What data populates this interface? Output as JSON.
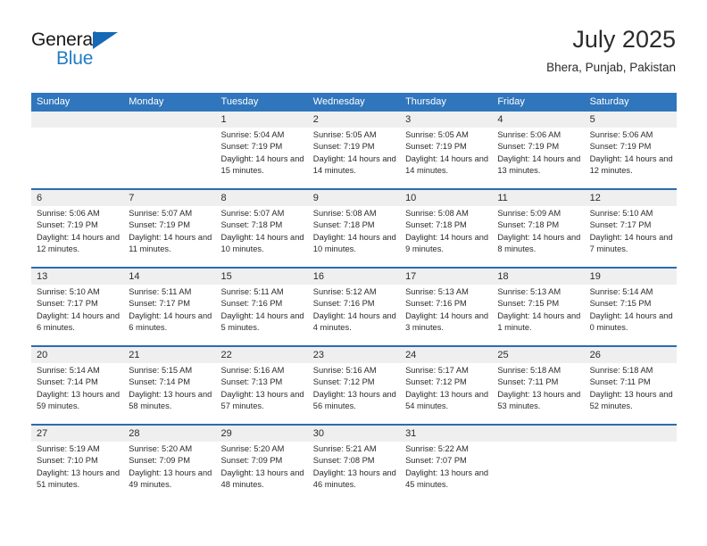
{
  "brand": {
    "name_part1": "General",
    "name_part2": "Blue",
    "triangle_color": "#1669b5",
    "blue_color": "#1f7ec4"
  },
  "header": {
    "title": "July 2025",
    "location": "Bhera, Punjab, Pakistan"
  },
  "theme": {
    "header_blue": "#3076bc",
    "separator_blue": "#2b6cad",
    "date_band_gray": "#efefef",
    "text_color": "#2b2b2b"
  },
  "weekdays": [
    "Sunday",
    "Monday",
    "Tuesday",
    "Wednesday",
    "Thursday",
    "Friday",
    "Saturday"
  ],
  "weeks": [
    [
      {
        "date": "",
        "sunrise": "",
        "sunset": "",
        "daylight": ""
      },
      {
        "date": "",
        "sunrise": "",
        "sunset": "",
        "daylight": ""
      },
      {
        "date": "1",
        "sunrise": "Sunrise: 5:04 AM",
        "sunset": "Sunset: 7:19 PM",
        "daylight": "Daylight: 14 hours and 15 minutes."
      },
      {
        "date": "2",
        "sunrise": "Sunrise: 5:05 AM",
        "sunset": "Sunset: 7:19 PM",
        "daylight": "Daylight: 14 hours and 14 minutes."
      },
      {
        "date": "3",
        "sunrise": "Sunrise: 5:05 AM",
        "sunset": "Sunset: 7:19 PM",
        "daylight": "Daylight: 14 hours and 14 minutes."
      },
      {
        "date": "4",
        "sunrise": "Sunrise: 5:06 AM",
        "sunset": "Sunset: 7:19 PM",
        "daylight": "Daylight: 14 hours and 13 minutes."
      },
      {
        "date": "5",
        "sunrise": "Sunrise: 5:06 AM",
        "sunset": "Sunset: 7:19 PM",
        "daylight": "Daylight: 14 hours and 12 minutes."
      }
    ],
    [
      {
        "date": "6",
        "sunrise": "Sunrise: 5:06 AM",
        "sunset": "Sunset: 7:19 PM",
        "daylight": "Daylight: 14 hours and 12 minutes."
      },
      {
        "date": "7",
        "sunrise": "Sunrise: 5:07 AM",
        "sunset": "Sunset: 7:19 PM",
        "daylight": "Daylight: 14 hours and 11 minutes."
      },
      {
        "date": "8",
        "sunrise": "Sunrise: 5:07 AM",
        "sunset": "Sunset: 7:18 PM",
        "daylight": "Daylight: 14 hours and 10 minutes."
      },
      {
        "date": "9",
        "sunrise": "Sunrise: 5:08 AM",
        "sunset": "Sunset: 7:18 PM",
        "daylight": "Daylight: 14 hours and 10 minutes."
      },
      {
        "date": "10",
        "sunrise": "Sunrise: 5:08 AM",
        "sunset": "Sunset: 7:18 PM",
        "daylight": "Daylight: 14 hours and 9 minutes."
      },
      {
        "date": "11",
        "sunrise": "Sunrise: 5:09 AM",
        "sunset": "Sunset: 7:18 PM",
        "daylight": "Daylight: 14 hours and 8 minutes."
      },
      {
        "date": "12",
        "sunrise": "Sunrise: 5:10 AM",
        "sunset": "Sunset: 7:17 PM",
        "daylight": "Daylight: 14 hours and 7 minutes."
      }
    ],
    [
      {
        "date": "13",
        "sunrise": "Sunrise: 5:10 AM",
        "sunset": "Sunset: 7:17 PM",
        "daylight": "Daylight: 14 hours and 6 minutes."
      },
      {
        "date": "14",
        "sunrise": "Sunrise: 5:11 AM",
        "sunset": "Sunset: 7:17 PM",
        "daylight": "Daylight: 14 hours and 6 minutes."
      },
      {
        "date": "15",
        "sunrise": "Sunrise: 5:11 AM",
        "sunset": "Sunset: 7:16 PM",
        "daylight": "Daylight: 14 hours and 5 minutes."
      },
      {
        "date": "16",
        "sunrise": "Sunrise: 5:12 AM",
        "sunset": "Sunset: 7:16 PM",
        "daylight": "Daylight: 14 hours and 4 minutes."
      },
      {
        "date": "17",
        "sunrise": "Sunrise: 5:13 AM",
        "sunset": "Sunset: 7:16 PM",
        "daylight": "Daylight: 14 hours and 3 minutes."
      },
      {
        "date": "18",
        "sunrise": "Sunrise: 5:13 AM",
        "sunset": "Sunset: 7:15 PM",
        "daylight": "Daylight: 14 hours and 1 minute."
      },
      {
        "date": "19",
        "sunrise": "Sunrise: 5:14 AM",
        "sunset": "Sunset: 7:15 PM",
        "daylight": "Daylight: 14 hours and 0 minutes."
      }
    ],
    [
      {
        "date": "20",
        "sunrise": "Sunrise: 5:14 AM",
        "sunset": "Sunset: 7:14 PM",
        "daylight": "Daylight: 13 hours and 59 minutes."
      },
      {
        "date": "21",
        "sunrise": "Sunrise: 5:15 AM",
        "sunset": "Sunset: 7:14 PM",
        "daylight": "Daylight: 13 hours and 58 minutes."
      },
      {
        "date": "22",
        "sunrise": "Sunrise: 5:16 AM",
        "sunset": "Sunset: 7:13 PM",
        "daylight": "Daylight: 13 hours and 57 minutes."
      },
      {
        "date": "23",
        "sunrise": "Sunrise: 5:16 AM",
        "sunset": "Sunset: 7:12 PM",
        "daylight": "Daylight: 13 hours and 56 minutes."
      },
      {
        "date": "24",
        "sunrise": "Sunrise: 5:17 AM",
        "sunset": "Sunset: 7:12 PM",
        "daylight": "Daylight: 13 hours and 54 minutes."
      },
      {
        "date": "25",
        "sunrise": "Sunrise: 5:18 AM",
        "sunset": "Sunset: 7:11 PM",
        "daylight": "Daylight: 13 hours and 53 minutes."
      },
      {
        "date": "26",
        "sunrise": "Sunrise: 5:18 AM",
        "sunset": "Sunset: 7:11 PM",
        "daylight": "Daylight: 13 hours and 52 minutes."
      }
    ],
    [
      {
        "date": "27",
        "sunrise": "Sunrise: 5:19 AM",
        "sunset": "Sunset: 7:10 PM",
        "daylight": "Daylight: 13 hours and 51 minutes."
      },
      {
        "date": "28",
        "sunrise": "Sunrise: 5:20 AM",
        "sunset": "Sunset: 7:09 PM",
        "daylight": "Daylight: 13 hours and 49 minutes."
      },
      {
        "date": "29",
        "sunrise": "Sunrise: 5:20 AM",
        "sunset": "Sunset: 7:09 PM",
        "daylight": "Daylight: 13 hours and 48 minutes."
      },
      {
        "date": "30",
        "sunrise": "Sunrise: 5:21 AM",
        "sunset": "Sunset: 7:08 PM",
        "daylight": "Daylight: 13 hours and 46 minutes."
      },
      {
        "date": "31",
        "sunrise": "Sunrise: 5:22 AM",
        "sunset": "Sunset: 7:07 PM",
        "daylight": "Daylight: 13 hours and 45 minutes."
      },
      {
        "date": "",
        "sunrise": "",
        "sunset": "",
        "daylight": ""
      },
      {
        "date": "",
        "sunrise": "",
        "sunset": "",
        "daylight": ""
      }
    ]
  ]
}
